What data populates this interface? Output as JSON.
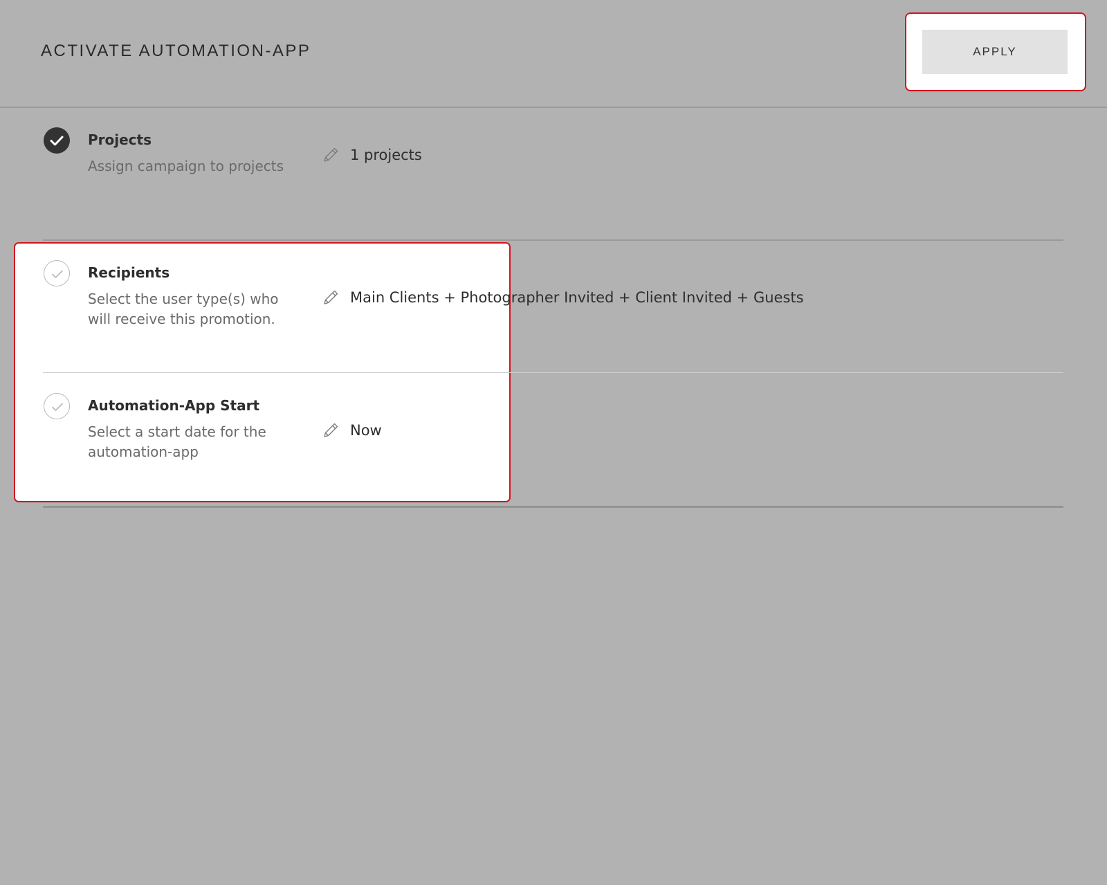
{
  "header": {
    "title": "ACTIVATE AUTOMATION-APP",
    "apply_label": "APPLY"
  },
  "steps": [
    {
      "title": "Projects",
      "description": "Assign campaign to projects",
      "value": "1 projects",
      "status": "completed",
      "status_icon": "check-filled-icon",
      "edit_icon": "pencil-icon"
    },
    {
      "title": "Recipients",
      "description": "Select the user type(s) who will receive this promotion.",
      "value": "Main Clients + Photographer Invited + Client Invited + Guests",
      "status": "incomplete",
      "status_icon": "check-outline-icon",
      "edit_icon": "pencil-icon"
    },
    {
      "title": "Automation-App Start",
      "description": "Select a start date for the automation-app",
      "value": "Now",
      "status": "incomplete",
      "status_icon": "check-outline-icon",
      "edit_icon": "pencil-icon"
    }
  ],
  "colors": {
    "overlay": "#b2b2b2",
    "highlight_border": "#d0151f",
    "button_bg": "#e2e2e2",
    "check_done": "#333333",
    "check_todo": "#b8b8b8"
  }
}
